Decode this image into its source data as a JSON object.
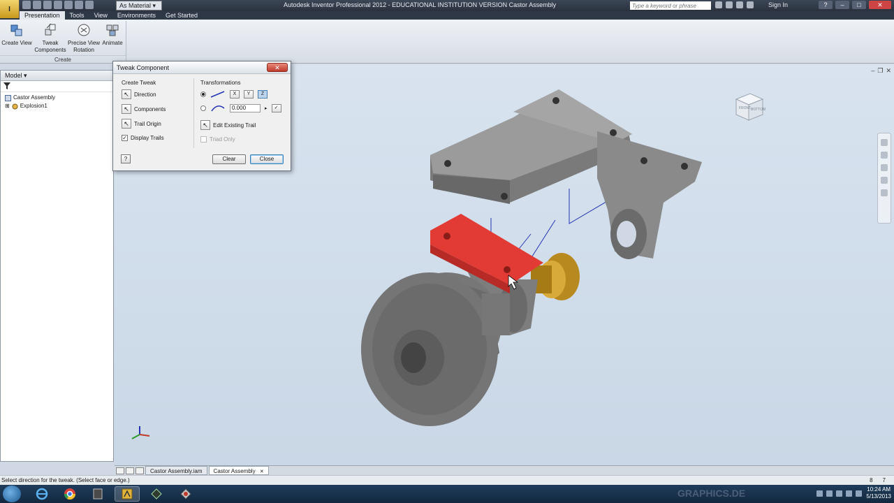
{
  "titlebar": {
    "app_badge": "I",
    "material": "As Material",
    "title": "Autodesk Inventor Professional 2012 - EDUCATIONAL INSTITUTION VERSION   Castor Assembly",
    "search_placeholder": "Type a keyword or phrase",
    "signin": "Sign In",
    "help": "?",
    "minimize": "–",
    "maximize": "□",
    "close": "✕"
  },
  "tabs": [
    "Presentation",
    "Tools",
    "View",
    "Environments",
    "Get Started"
  ],
  "ribbon": {
    "buttons": [
      {
        "label_1": "Create View",
        "label_2": ""
      },
      {
        "label_1": "Tweak",
        "label_2": "Components"
      },
      {
        "label_1": "Precise View",
        "label_2": "Rotation"
      },
      {
        "label_1": "Animate",
        "label_2": ""
      }
    ],
    "panel_label": "Create"
  },
  "browser": {
    "header": "Model ▾",
    "tree": [
      {
        "label": "Castor Assembly"
      },
      {
        "label": "Explosion1"
      }
    ]
  },
  "dialog": {
    "title": "Tweak Component",
    "close": "✕",
    "create_tweak": {
      "label": "Create Tweak",
      "direction": "Direction",
      "components": "Components",
      "trail_origin": "Trail Origin",
      "display_trails": "Display Trails",
      "display_trails_checked": true
    },
    "transformations": {
      "label": "Transformations",
      "axes": [
        "X",
        "Y",
        "Z"
      ],
      "active_axis": "Z",
      "value": "0.000",
      "edit_existing_trail": "Edit Existing Trail",
      "triad_only": "Triad Only"
    },
    "help": "?",
    "clear": "Clear",
    "close_btn": "Close"
  },
  "viewcube": {
    "front": "FRONT",
    "bottom": "BOTTOM"
  },
  "viewport_ctrls": [
    "–",
    "❐",
    "✕"
  ],
  "doctabs": [
    {
      "label": "Castor Assembly.iam"
    },
    {
      "label": "Castor Assembly",
      "close": "✕"
    }
  ],
  "status": {
    "message": "Select direction for the tweak. (Select face or edge.)",
    "count_1": "8",
    "count_2": "7"
  },
  "taskbar": {
    "watermark": "GRAPHICS.DE",
    "time": "10:24 AM",
    "date": "5/13/2013"
  },
  "colors": {
    "selected_part": "#e23a34",
    "bronze_part": "#b78a1f",
    "metal": "#6e6e6e",
    "trail": "#2434b4"
  }
}
